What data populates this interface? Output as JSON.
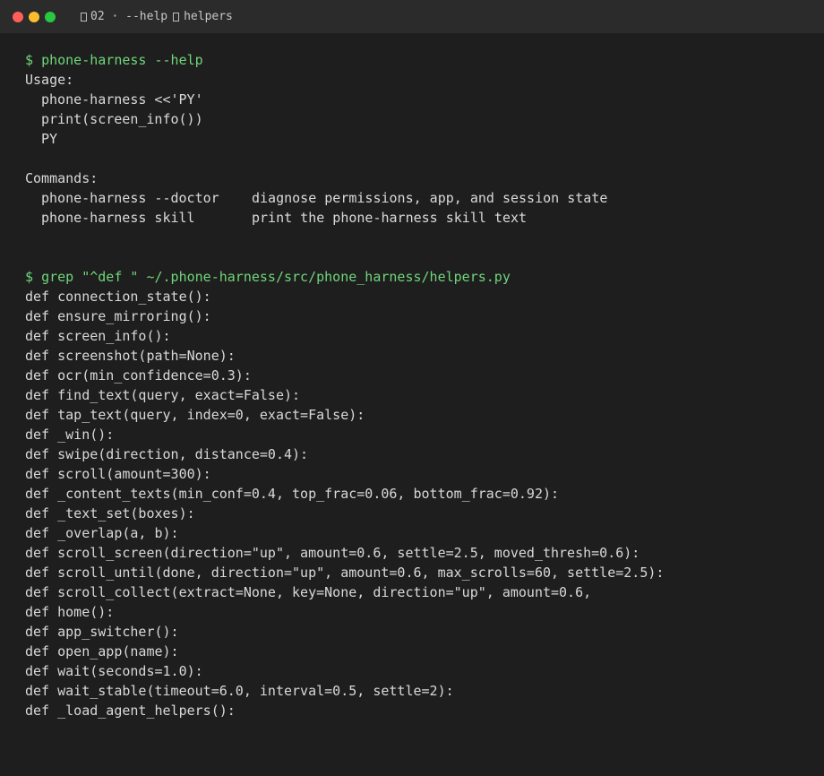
{
  "window": {
    "title_part1": "02 · --help",
    "title_part2": "helpers",
    "traffic_colors": {
      "close": "#ff5f57",
      "minimize": "#febc2e",
      "maximize": "#28c840"
    }
  },
  "colors": {
    "background": "#1e1e1e",
    "titlebar": "#2b2b2b",
    "prompt": "#6fd67a",
    "text": "#d9d9d9"
  },
  "block1": {
    "prompt": "$",
    "command": "phone-harness --help",
    "usage_label": "Usage:",
    "usage_lines": [
      "phone-harness <<'PY'",
      "print(screen_info())",
      "PY"
    ],
    "commands_label": "Commands:",
    "commands": [
      {
        "cmd": "phone-harness --doctor",
        "desc": "diagnose permissions, app, and session state"
      },
      {
        "cmd": "phone-harness skill",
        "desc": "print the phone-harness skill text"
      }
    ]
  },
  "block2": {
    "prompt": "$",
    "command": "grep \"^def \" ~/.phone-harness/src/phone_harness/helpers.py",
    "defs": [
      "def connection_state():",
      "def ensure_mirroring():",
      "def screen_info():",
      "def screenshot(path=None):",
      "def ocr(min_confidence=0.3):",
      "def find_text(query, exact=False):",
      "def tap_text(query, index=0, exact=False):",
      "def _win():",
      "def swipe(direction, distance=0.4):",
      "def scroll(amount=300):",
      "def _content_texts(min_conf=0.4, top_frac=0.06, bottom_frac=0.92):",
      "def _text_set(boxes):",
      "def _overlap(a, b):",
      "def scroll_screen(direction=\"up\", amount=0.6, settle=2.5, moved_thresh=0.6):",
      "def scroll_until(done, direction=\"up\", amount=0.6, max_scrolls=60, settle=2.5):",
      "def scroll_collect(extract=None, key=None, direction=\"up\", amount=0.6,",
      "def home():",
      "def app_switcher():",
      "def open_app(name):",
      "def wait(seconds=1.0):",
      "def wait_stable(timeout=6.0, interval=0.5, settle=2):",
      "def _load_agent_helpers():"
    ]
  }
}
